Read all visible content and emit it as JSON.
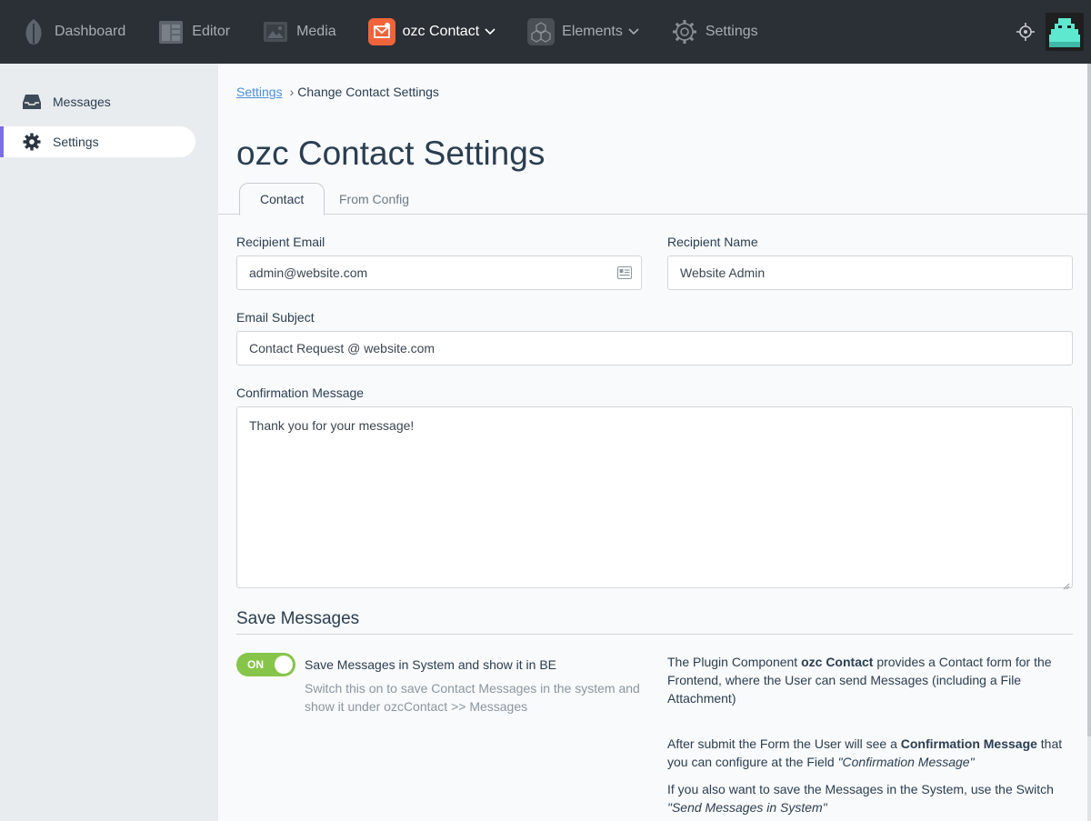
{
  "topnav": {
    "items": [
      {
        "label": "Dashboard",
        "icon": "leaf-icon"
      },
      {
        "label": "Editor",
        "icon": "editor-icon"
      },
      {
        "label": "Media",
        "icon": "media-icon"
      },
      {
        "label": "ozc Contact",
        "icon": "ozc-contact-icon",
        "active": true,
        "caret": "⌄"
      },
      {
        "label": "Elements",
        "icon": "elements-icon",
        "caret": "⌄"
      },
      {
        "label": "Settings",
        "icon": "gear-icon"
      }
    ]
  },
  "sidebar": {
    "items": [
      {
        "label": "Messages",
        "icon": "inbox-icon"
      },
      {
        "label": "Settings",
        "icon": "gear-icon",
        "active": true
      }
    ]
  },
  "breadcrumb": {
    "link": "Settings",
    "separator": "›",
    "current": "Change Contact Settings"
  },
  "page_title": "ozc Contact Settings",
  "tabs": [
    {
      "label": "Contact",
      "active": true
    },
    {
      "label": "From Config"
    }
  ],
  "form": {
    "recipient_email": {
      "label": "Recipient Email",
      "value": "admin@website.com"
    },
    "recipient_name": {
      "label": "Recipient Name",
      "value": "Website Admin"
    },
    "email_subject": {
      "label": "Email Subject",
      "value": "Contact Request @ website.com"
    },
    "confirmation_message": {
      "label": "Confirmation Message",
      "value": "Thank you for your message!"
    }
  },
  "save_messages": {
    "section_title": "Save Messages",
    "switch_state": "ON",
    "switch_label": "Save Messages in System and show it in BE",
    "switch_help": "Switch this on to save Contact Messages in the system and show it under ozcContact >> Messages"
  },
  "info": {
    "p1_a": "The Plugin Component ",
    "p1_b": "ozc Contact",
    "p1_c": " provides a Contact form for the Frontend, where the User can send Messages (including a File Attachment)",
    "p2_a": "After submit the Form the User will see a ",
    "p2_b": "Confirmation Message",
    "p2_c": " that you can configure at the Field ",
    "p2_d": "\"Confirmation Message\"",
    "p3_a": "If you also want to save the Messages in the System, use the Switch ",
    "p3_b": "\"Send Messages in System\""
  },
  "colors": {
    "topbar": "#2b3036",
    "accent": "#7b6fe8",
    "switch_on": "#86c54a",
    "link": "#4a90d9",
    "ozc_icon": "#f0643c"
  }
}
